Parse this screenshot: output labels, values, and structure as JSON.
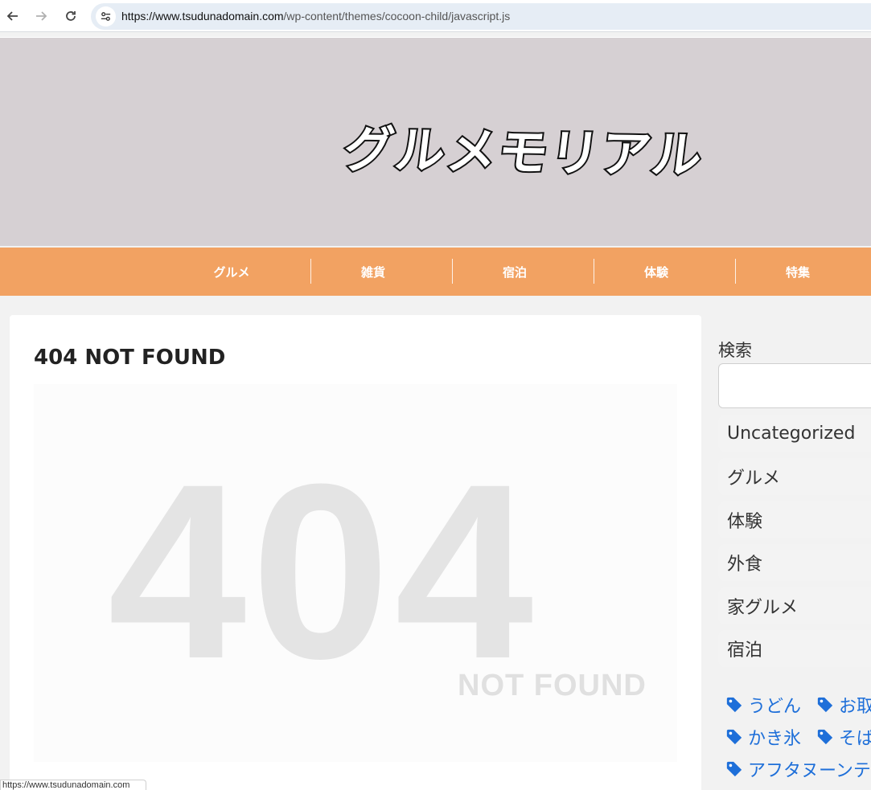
{
  "browser": {
    "url_host": "https://www.tsudunadomain.com",
    "url_path": "/wp-content/themes/cocoon-child/javascript.js"
  },
  "header": {
    "logo_text": "グルメモリアル",
    "background_color": "#d6d0d3"
  },
  "nav": {
    "background_color": "#f2a262",
    "items": [
      {
        "label": "グルメ"
      },
      {
        "label": "雑貨"
      },
      {
        "label": "宿泊"
      },
      {
        "label": "体験"
      },
      {
        "label": "特集"
      }
    ]
  },
  "main": {
    "title": "404 NOT FOUND",
    "image_big_text": "404",
    "image_small_text": "NOT FOUND"
  },
  "sidebar": {
    "search_label": "検索",
    "search_placeholder": "",
    "categories": [
      {
        "label": "Uncategorized"
      },
      {
        "label": "グルメ"
      },
      {
        "label": "体験"
      },
      {
        "label": "外食"
      },
      {
        "label": "家グルメ"
      },
      {
        "label": "宿泊"
      }
    ],
    "tags": [
      {
        "label": "うどん"
      },
      {
        "label": "お取"
      },
      {
        "label": "かき氷"
      },
      {
        "label": "そば"
      },
      {
        "label": "アフタヌーンテ"
      }
    ],
    "tag_color": "#1e6fd9"
  },
  "status_bar": {
    "url": "https://www.tsudunadomain.com"
  }
}
